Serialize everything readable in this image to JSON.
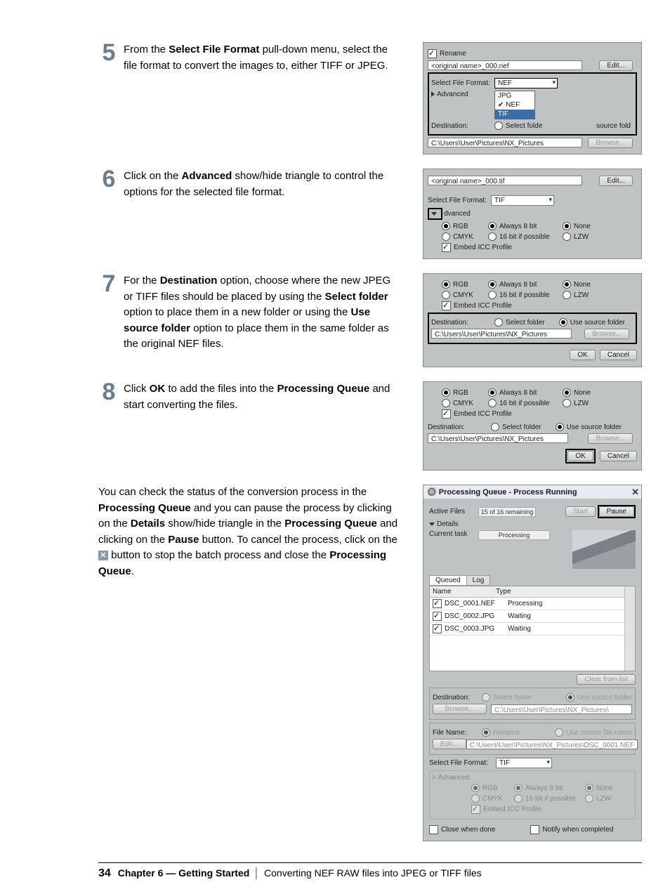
{
  "steps": {
    "5": {
      "num": "5",
      "text_before": "From the ",
      "b1": "Select File Format",
      "text_mid": " pull-down menu, select the file format to convert the images to, either TIFF or JPEG."
    },
    "6": {
      "num": "6",
      "text_before": "Click on the ",
      "b1": "Advanced",
      "text_after": " show/hide triangle to control the options for the selected file format."
    },
    "7": {
      "num": "7",
      "t1": "For the ",
      "b1": "Destination",
      "t2": " option, choose where the new JPEG or TIFF files should be placed by using the ",
      "b2": "Select folder",
      "t3": " option to place them in a new folder or using the ",
      "b3": "Use source folder",
      "t4": " option to place them in the same folder as the original NEF files."
    },
    "8": {
      "num": "8",
      "t1": "Click ",
      "b1": "OK",
      "t2": " to add the files into the ",
      "b2": "Processing Queue",
      "t3": " and start converting the files."
    }
  },
  "para": {
    "t1": "You can check the status of the conversion process in the ",
    "b1": "Processing Queue",
    "t2": " and you can pause the process by clicking on the ",
    "b2": "Details",
    "t3": " show/hide triangle in the ",
    "b3": "Processing Queue",
    "t4": " and clicking on the ",
    "b4": "Pause",
    "t5": " button. To cancel the process, click on the ",
    "t6": " button to stop the batch process and close the ",
    "b5": "Processing Queue",
    "t7": "."
  },
  "shot5": {
    "rename": "Rename",
    "name_field": "<original name>_000.nef",
    "edit": "Edit...",
    "sff": "Select File Format:",
    "adv": "Advanced",
    "cur": "NEF",
    "opt_jpg": "JPG",
    "opt_nef": "NEF",
    "opt_tif": "TIF",
    "dest": "Destination:",
    "sel_folder": "Select folde",
    "use_src": "source fold",
    "path": "C:\\Users\\User\\Pictures\\NX_Pictures",
    "browse": "Browse..."
  },
  "shot6": {
    "name_field": "<original name>_000.tif",
    "edit": "Edit...",
    "sff": "Select File Format:",
    "fmt": "TIF",
    "adv": "dvanced",
    "rgb": "RGB",
    "cmyk": "CMYK",
    "a8": "Always 8 bit",
    "b16": "16 bit if possible",
    "none": "None",
    "lzw": "LZW",
    "icc": "Embed ICC Profile"
  },
  "shot7": {
    "rgb": "RGB",
    "cmyk": "CMYK",
    "a8": "Always 8 bit",
    "b16": "16 bit if possible",
    "none": "None",
    "lzw": "LZW",
    "icc": "Embed ICC Profile",
    "dest": "Destination:",
    "sel_folder": "Select folder",
    "use_src": "Use source folder",
    "path": "C:\\Users\\User\\Pictures\\NX_Pictures",
    "browse": "Browse...",
    "ok": "OK",
    "cancel": "Cancel"
  },
  "shot8": {
    "rgb": "RGB",
    "cmyk": "CMYK",
    "a8": "Always 8 bit",
    "b16": "16 bit if possible",
    "none": "None",
    "lzw": "LZW",
    "icc": "Embed ICC Profile",
    "dest": "Destination:",
    "sel_folder": "Select folder",
    "use_src": "Use source folder",
    "path": "C:\\Users\\User\\Pictures\\NX_Pictures",
    "browse": "Browse...",
    "ok": "OK",
    "cancel": "Cancel"
  },
  "pq": {
    "title": "Processing Queue - Process Running",
    "active": "Active Files",
    "remain": "15 of 16 remaining",
    "start": "Start",
    "pause": "Pause",
    "details": "Details",
    "curtask": "Current task",
    "processing": "Processing",
    "tab_q": "Queued",
    "tab_log": "Log",
    "hdr_name": "Name",
    "hdr_type": "Type",
    "r1_name": "DSC_0001.NEF",
    "r1_stat": "Processing",
    "r2_name": "DSC_0002.JPG",
    "r2_stat": "Waiting",
    "r3_name": "DSC_0003.JPG",
    "r3_stat": "Waiting",
    "clear": "Clear from list",
    "dest": "Destination:",
    "sel_folder": "Select folder",
    "use_src": "Use source folder",
    "browse": "Browse...",
    "path": "C:\\Users\\User\\Pictures\\NX_Pictures\\",
    "fname": "File Name:",
    "rename": "Rename",
    "use_src_name": "Use source file name",
    "edit": "Edit...",
    "path2": "C:\\Users\\User\\Pictures\\NX_Pictures\\DSC_0001.NEF",
    "sff": "Select File Format:",
    "fmt": "TIF",
    "adv": "Advanced",
    "rgb": "RGB",
    "cmyk": "CMYK",
    "a8": "Always 8 bit",
    "b16": "16 bit if possible",
    "none": "None",
    "lzw": "LZW",
    "icc": "Embed ICC Profile",
    "close_done": "Close when done",
    "notify": "Notify when completed"
  },
  "footer": {
    "page": "34",
    "chapter": "Chapter 6 — Getting Started",
    "section": "Converting NEF RAW files into JPEG or TIFF files"
  }
}
